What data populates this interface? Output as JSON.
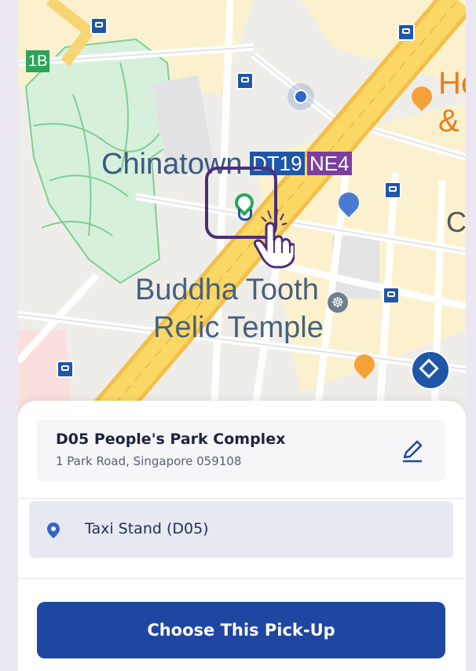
{
  "map": {
    "labels": {
      "chinatown": "Chinatown",
      "temple_line1": "Buddha Tooth",
      "temple_line2": "Relic Temple",
      "partial_he": "He",
      "partial_amp": "&",
      "partial_c": "C"
    },
    "mrt_codes": {
      "dt": "DT19",
      "ne": "NE4",
      "exit": "1B"
    },
    "colors": {
      "dt_line": "#1e57a8",
      "ne_line": "#7b3fa0",
      "exit_badge": "#2ca55a",
      "park": "#c9ecd2",
      "road_major": "#f6cc4e",
      "road_fill": "#fbe9a6"
    }
  },
  "pickup": {
    "title": "D05 People's Park Complex",
    "address": "1 Park Road, Singapore 059108",
    "edit_icon": "pencil-icon"
  },
  "option": {
    "label": "Taxi Stand (D05)",
    "icon": "location-pin-icon"
  },
  "cta": {
    "label": "Choose This Pick-Up"
  },
  "colors": {
    "accent": "#1f46a0",
    "background": "#ebe7f3",
    "option_bg": "#e6e9f2"
  }
}
